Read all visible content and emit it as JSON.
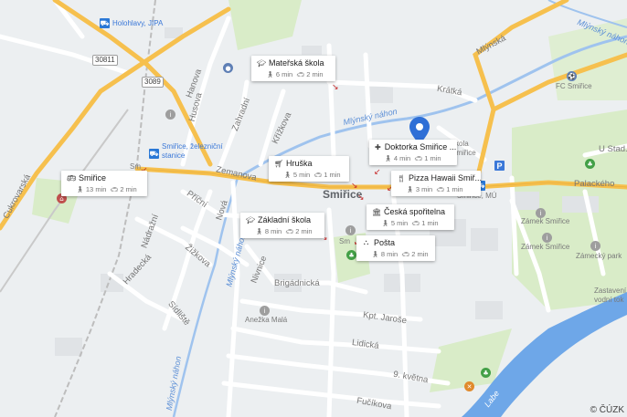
{
  "attribution": "© ČÚZK",
  "town_label": "Smiřice",
  "road_numbers": [
    "30811",
    "3089"
  ],
  "water_labels": [
    "Mlýnský náhon",
    "Mlýnský náhon",
    "Mlýnský náhon",
    "Mlýnský náhon",
    "Labe"
  ],
  "streets": {
    "zemanova": "Zemanova",
    "cukrovarska": "Cukrovarská",
    "myrna": "Mlýnská",
    "kratka": "Krátká",
    "palackeho": "Palackého",
    "husova": "Husova",
    "hanova": "Hanova",
    "zahradni": "Zahradní",
    "krizova": "Křížkova",
    "pricni": "Příční",
    "nova": "Nová",
    "nadrazni": "Nádražní",
    "hradecka": "Hradecká",
    "zizkova": "Žižkova",
    "sidliste": "Sídliště",
    "nivnicova": "Nivnice",
    "brigadnicka": "Brigádnická",
    "kpt_jarose": "Kpt. Jaroše",
    "lidicka": "Lidická",
    "kvetna": "9. května",
    "fucikova": "Fučíkova",
    "u_stadionu": "U Stad..."
  },
  "poi_labels": {
    "holohlavy": "Holohlavy, JIPA",
    "smirice_station": "Smiřice, železniční stanice",
    "fc": "FC Smiřice",
    "skola": "škola Smiřice",
    "namesti": "Smiřice, MÚ",
    "zamek": "Zámek Smiřice",
    "zamek2": "Zámek Smiřice",
    "zamecky_park": "Zámecký park",
    "anezka": "Anežka Malá",
    "vodni": "Zastavení vodní tok",
    "sm": "Sm",
    "sm2": "Sm"
  },
  "cards": [
    {
      "name": "Mateřská škola",
      "icon": "school-icon",
      "walk": "6 min",
      "drive": "2 min"
    },
    {
      "name": "Doktorka Smiřice ...",
      "icon": "medical-icon",
      "walk": "4 min",
      "drive": "1 min"
    },
    {
      "name": "Hruška",
      "icon": "cart-icon",
      "walk": "5 min",
      "drive": "1 min"
    },
    {
      "name": "Pizza Hawaii Smiř...",
      "icon": "restaurant-icon",
      "walk": "3 min",
      "drive": "1 min"
    },
    {
      "name": "Smiřice",
      "icon": "bus-icon",
      "walk": "13 min",
      "drive": "2 min"
    },
    {
      "name": "Česká spořitelna",
      "icon": "bank-icon",
      "walk": "5 min",
      "drive": "1 min"
    },
    {
      "name": "Základní škola",
      "icon": "school-icon",
      "walk": "8 min",
      "drive": "2 min"
    },
    {
      "name": "Pošta",
      "icon": "post-icon",
      "walk": "8 min",
      "drive": "2 min"
    }
  ],
  "colors": {
    "background": "#eceff1",
    "major_road": "#f6c04e",
    "minor_road": "#ffffff",
    "river": "#6ea7e8",
    "park": "#d9ecc8",
    "pin": "#2f6fd6",
    "arrow": "#c62828"
  }
}
